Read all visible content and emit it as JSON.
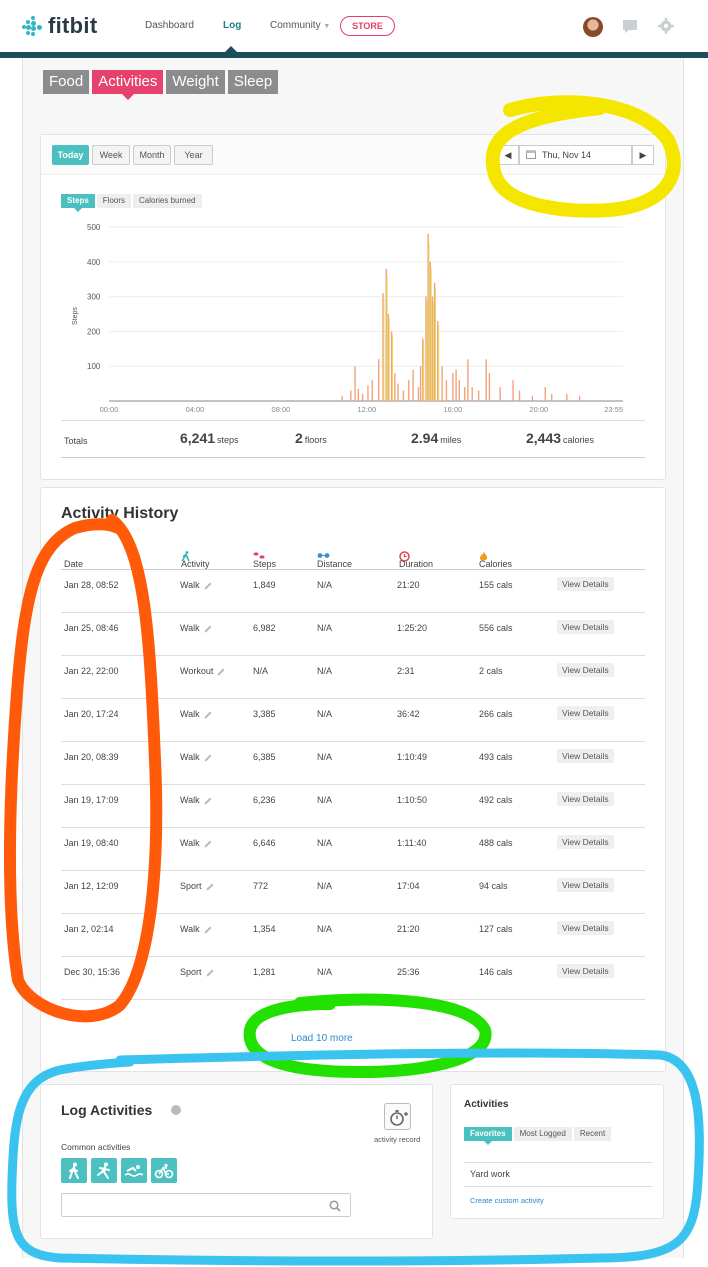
{
  "app": {
    "brand": "fitbit"
  },
  "nav": {
    "items": [
      {
        "label": "Dashboard"
      },
      {
        "label": "Log"
      },
      {
        "label": "Community"
      }
    ],
    "store_label": "STORE"
  },
  "category_tabs": [
    "Food",
    "Activities",
    "Weight",
    "Sleep"
  ],
  "date_range": {
    "buttons": [
      "Today",
      "Week",
      "Month",
      "Year"
    ],
    "active": "Today",
    "current_date": "Thu, Nov 14"
  },
  "metric_tabs": [
    "Steps",
    "Floors",
    "Calories burned"
  ],
  "chart_data": {
    "type": "bar",
    "ylabel": "Steps",
    "ylim": [
      0,
      500
    ],
    "yticks": [
      100,
      200,
      300,
      400,
      500
    ],
    "xtick_labels": [
      "00:00",
      "04:00",
      "08:00",
      "12:00",
      "16:00",
      "20:00",
      "23:55"
    ],
    "grid": true,
    "x_unit": "hour of day",
    "series": [
      {
        "values": [
          [
            10.85,
            15
          ],
          [
            11.25,
            30
          ],
          [
            11.45,
            100
          ],
          [
            11.6,
            35
          ],
          [
            11.8,
            20
          ],
          [
            12.05,
            45
          ],
          [
            12.25,
            60
          ],
          [
            12.55,
            120
          ],
          [
            12.75,
            310
          ],
          [
            12.9,
            380
          ],
          [
            13.0,
            250
          ],
          [
            13.15,
            200
          ],
          [
            13.3,
            80
          ],
          [
            13.45,
            50
          ],
          [
            13.7,
            30
          ],
          [
            13.95,
            60
          ],
          [
            14.15,
            90
          ],
          [
            14.4,
            40
          ],
          [
            14.5,
            100
          ],
          [
            14.6,
            180
          ],
          [
            14.75,
            300
          ],
          [
            14.85,
            480
          ],
          [
            14.95,
            400
          ],
          [
            15.05,
            300
          ],
          [
            15.15,
            340
          ],
          [
            15.3,
            230
          ],
          [
            15.5,
            100
          ],
          [
            15.7,
            60
          ],
          [
            16.0,
            80
          ],
          [
            16.15,
            90
          ],
          [
            16.3,
            60
          ],
          [
            16.55,
            40
          ],
          [
            16.7,
            120
          ],
          [
            16.9,
            40
          ],
          [
            17.2,
            30
          ],
          [
            17.55,
            120
          ],
          [
            17.7,
            80
          ],
          [
            18.2,
            40
          ],
          [
            18.8,
            60
          ],
          [
            19.1,
            30
          ],
          [
            19.7,
            15
          ],
          [
            20.3,
            40
          ],
          [
            20.6,
            20
          ],
          [
            21.3,
            20
          ],
          [
            21.9,
            15
          ]
        ]
      }
    ]
  },
  "totals": {
    "label": "Totals",
    "steps_value": "6,241",
    "steps_unit": "steps",
    "floors_value": "2",
    "floors_unit": "floors",
    "miles_value": "2.94",
    "miles_unit": "miles",
    "calories_value": "2,443",
    "calories_unit": "calories"
  },
  "history": {
    "title": "Activity History",
    "columns": [
      "Date",
      "Activity",
      "Steps",
      "Distance",
      "Duration",
      "Calories"
    ],
    "rows": [
      {
        "date": "Jan 28, 08:52",
        "activity": "Walk",
        "steps": "1,849",
        "distance": "N/A",
        "duration": "21:20",
        "calories": "155 cals"
      },
      {
        "date": "Jan 25, 08:46",
        "activity": "Walk",
        "steps": "6,982",
        "distance": "N/A",
        "duration": "1:25:20",
        "calories": "556 cals"
      },
      {
        "date": "Jan 22, 22:00",
        "activity": "Workout",
        "steps": "N/A",
        "distance": "N/A",
        "duration": "2:31",
        "calories": "2 cals"
      },
      {
        "date": "Jan 20, 17:24",
        "activity": "Walk",
        "steps": "3,385",
        "distance": "N/A",
        "duration": "36:42",
        "calories": "266 cals"
      },
      {
        "date": "Jan 20, 08:39",
        "activity": "Walk",
        "steps": "6,385",
        "distance": "N/A",
        "duration": "1:10:49",
        "calories": "493 cals"
      },
      {
        "date": "Jan 19, 17:09",
        "activity": "Walk",
        "steps": "6,236",
        "distance": "N/A",
        "duration": "1:10:50",
        "calories": "492 cals"
      },
      {
        "date": "Jan 19, 08:40",
        "activity": "Walk",
        "steps": "6,646",
        "distance": "N/A",
        "duration": "1:11:40",
        "calories": "488 cals"
      },
      {
        "date": "Jan 12, 12:09",
        "activity": "Sport",
        "steps": "772",
        "distance": "N/A",
        "duration": "17:04",
        "calories": "94 cals"
      },
      {
        "date": "Jan 2, 02:14",
        "activity": "Walk",
        "steps": "1,354",
        "distance": "N/A",
        "duration": "21:20",
        "calories": "127 cals"
      },
      {
        "date": "Dec 30, 15:36",
        "activity": "Sport",
        "steps": "1,281",
        "distance": "N/A",
        "duration": "25:36",
        "calories": "146 cals"
      }
    ],
    "view_details_label": "View Details",
    "load_more_label": "Load 10 more"
  },
  "log": {
    "title": "Log Activities",
    "activity_record_label": "activity record",
    "common_label": "Common activities",
    "common_icons": [
      "walk-icon",
      "run-icon",
      "swim-icon",
      "bike-icon"
    ],
    "search_placeholder": ""
  },
  "side": {
    "title": "Activities",
    "tabs": [
      "Favorites",
      "Most Logged",
      "Recent"
    ],
    "items": [
      "Yard work"
    ],
    "custom_link": "Create custom activity"
  },
  "colors": {
    "teal": "#4cc0c0",
    "pink": "#e7426d",
    "nav_dark": "#1e4e5a",
    "link": "#2a89c9",
    "bar_orange": "#f2a37e",
    "bar_yellow": "#e6df5a"
  }
}
